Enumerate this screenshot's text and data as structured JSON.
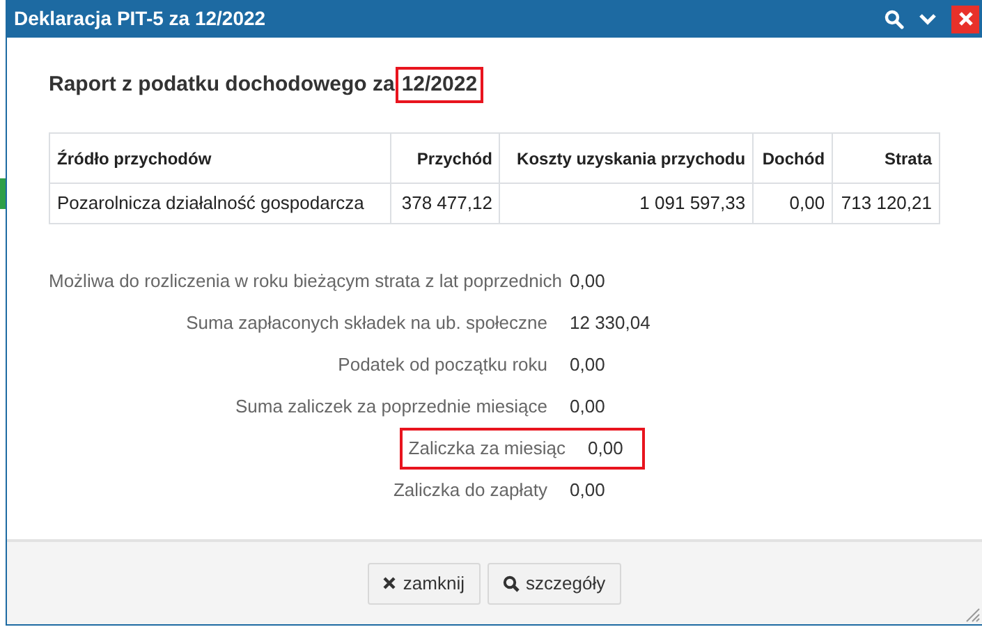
{
  "window": {
    "title": "Deklaracja PIT-5 za 12/2022",
    "controls": [
      {
        "kind": "search"
      },
      {
        "kind": "collapse"
      },
      {
        "kind": "close"
      }
    ]
  },
  "report": {
    "title": "Raport z podatku dochodowego za",
    "period": "12/2022",
    "period_highlighted": true
  },
  "table": {
    "columns": [
      "Źródło przychodów",
      "Przychód",
      "Koszty uzyskania przychodu",
      "Dochód",
      "Strata"
    ],
    "rows": [
      [
        "Pozarolnicza działalność gospodarcza",
        "378 477,12",
        "1 091 597,33",
        "0,00",
        "713 120,21"
      ]
    ]
  },
  "summary": [
    {
      "label": "Możliwa do rozliczenia w roku bieżącym strata z lat poprzednich",
      "value": "0,00",
      "highlighted": false
    },
    {
      "label": "Suma zapłaconych składek na ub. społeczne",
      "value": "12 330,04",
      "highlighted": false
    },
    {
      "label": "Podatek od początku roku",
      "value": "0,00",
      "highlighted": false
    },
    {
      "label": "Suma zaliczek za poprzednie miesiące",
      "value": "0,00",
      "highlighted": false
    },
    {
      "label": "Zaliczka za miesiąc",
      "value": "0,00",
      "highlighted": true
    },
    {
      "label": "Zaliczka do zapłaty",
      "value": "0,00",
      "highlighted": false
    }
  ],
  "buttons": [
    {
      "label": "zamknij",
      "kind": "close"
    },
    {
      "label": "szczegóły",
      "kind": "details"
    }
  ]
}
